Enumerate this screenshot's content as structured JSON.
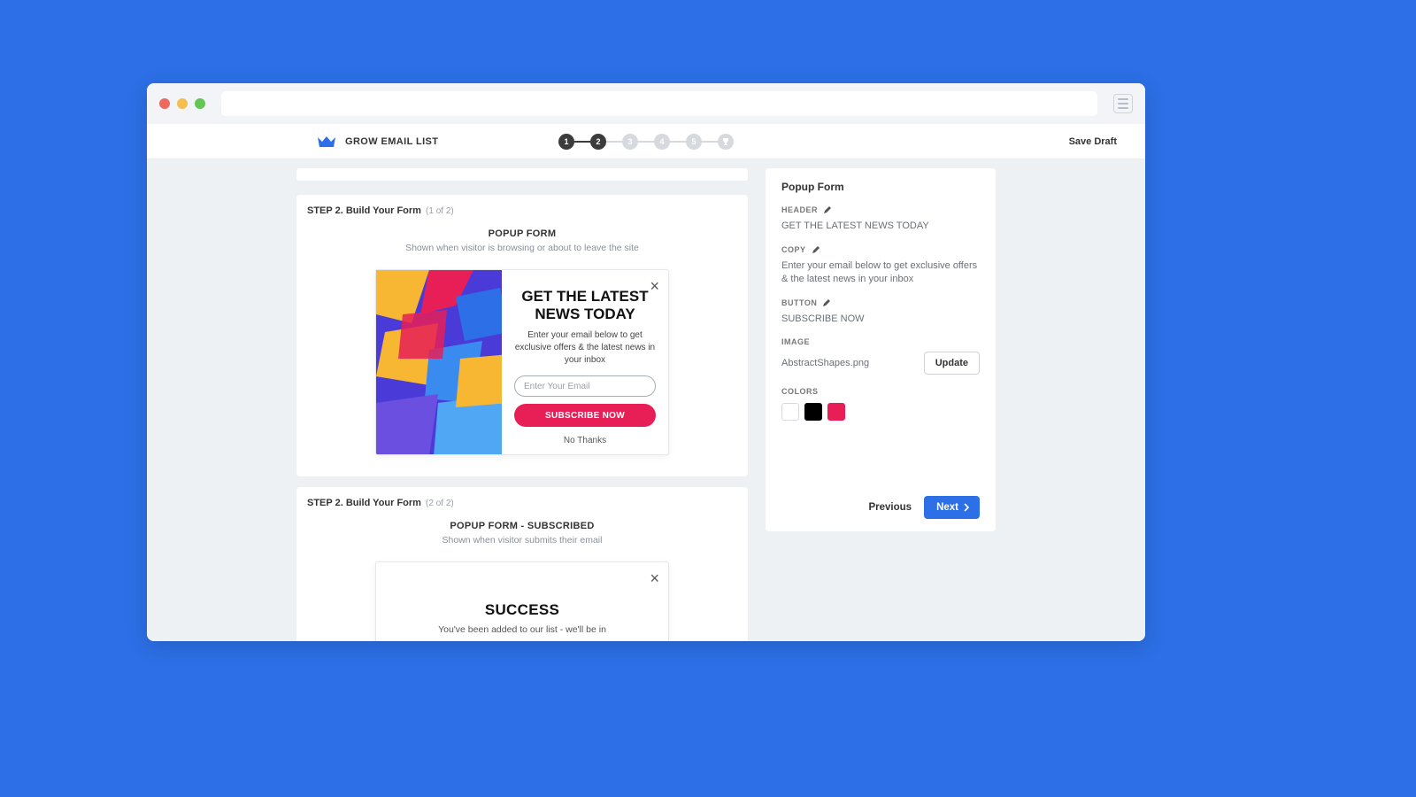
{
  "header": {
    "title": "GROW EMAIL LIST",
    "save_draft": "Save Draft",
    "steps": [
      "1",
      "2",
      "3",
      "4",
      "5"
    ],
    "active_step": 2
  },
  "form1": {
    "step_label": "STEP 2. Build Your Form",
    "step_sub": "(1 of 2)",
    "title": "POPUP FORM",
    "desc": "Shown when visitor is browsing or about to leave the site",
    "heading_line1": "GET THE LATEST",
    "heading_line2": "NEWS TODAY",
    "copy": "Enter your email below to get exclusive offers & the latest news in your inbox",
    "input_placeholder": "Enter Your Email",
    "button": "SUBSCRIBE NOW",
    "no_thanks": "No Thanks"
  },
  "form2": {
    "step_label": "STEP 2. Build Your Form",
    "step_sub": "(2 of 2)",
    "title": "POPUP FORM - SUBSCRIBED",
    "desc": "Shown when visitor submits their email",
    "heading": "SUCCESS",
    "copy": "You've been added to our list - we'll be in"
  },
  "sidebar": {
    "title": "Popup Form",
    "labels": {
      "header": "HEADER",
      "copy": "COPY",
      "button": "BUTTON",
      "image": "IMAGE",
      "colors": "COLORS"
    },
    "header_value": "GET THE LATEST NEWS TODAY",
    "copy_value": "Enter your email below to get exclusive offers & the latest news in your inbox",
    "button_value": "SUBSCRIBE NOW",
    "image_value": "AbstractShapes.png",
    "update": "Update",
    "colors": [
      "#ffffff",
      "#000000",
      "#e81f57"
    ],
    "previous": "Previous",
    "next": "Next"
  }
}
